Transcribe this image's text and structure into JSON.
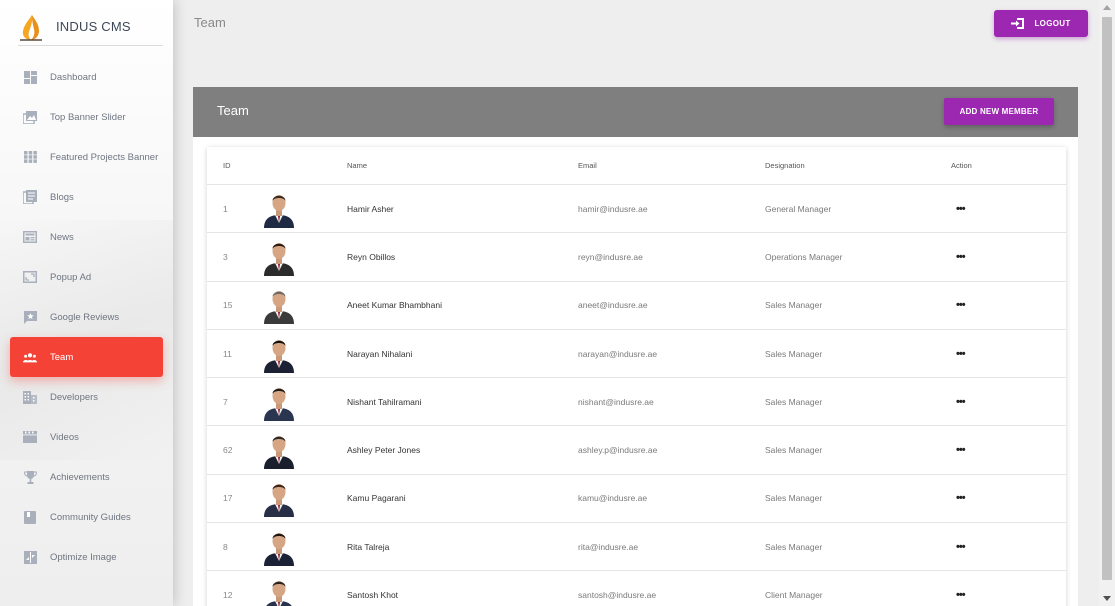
{
  "app": {
    "name": "INDUS CMS"
  },
  "header": {
    "page_title": "Team",
    "logout_label": "LOGOUT"
  },
  "sidebar": {
    "items": [
      {
        "label": "Dashboard",
        "icon": "dashboard-icon"
      },
      {
        "label": "Top Banner Slider",
        "icon": "image-icon"
      },
      {
        "label": "Featured Projects Banner",
        "icon": "grid-icon"
      },
      {
        "label": "Blogs",
        "icon": "blog-icon"
      },
      {
        "label": "News",
        "icon": "news-icon"
      },
      {
        "label": "Popup Ad",
        "icon": "popup-icon"
      },
      {
        "label": "Google Reviews",
        "icon": "review-icon"
      },
      {
        "label": "Team",
        "icon": "team-icon",
        "active": true
      },
      {
        "label": "Developers",
        "icon": "building-icon"
      },
      {
        "label": "Videos",
        "icon": "video-icon"
      },
      {
        "label": "Achievements",
        "icon": "trophy-icon"
      },
      {
        "label": "Community Guides",
        "icon": "book-icon"
      },
      {
        "label": "Optimize Image",
        "icon": "compress-icon"
      }
    ]
  },
  "card": {
    "title": "Team",
    "add_button": "ADD NEW MEMBER"
  },
  "table": {
    "headers": {
      "id": "ID",
      "name": "Name",
      "email": "Email",
      "designation": "Designation",
      "action": "Action"
    },
    "rows": [
      {
        "id": "1",
        "name": "Hamir Asher",
        "email": "hamir@indusre.ae",
        "designation": "General Manager"
      },
      {
        "id": "3",
        "name": "Reyn Obillos",
        "email": "reyn@indusre.ae",
        "designation": "Operations Manager"
      },
      {
        "id": "15",
        "name": "Aneet Kumar Bhambhani",
        "email": "aneet@indusre.ae",
        "designation": "Sales Manager"
      },
      {
        "id": "11",
        "name": "Narayan Nihalani",
        "email": "narayan@indusre.ae",
        "designation": "Sales Manager"
      },
      {
        "id": "7",
        "name": "Nishant Tahilramani",
        "email": "nishant@indusre.ae",
        "designation": "Sales Manager"
      },
      {
        "id": "62",
        "name": "Ashley Peter Jones",
        "email": "ashley.p@indusre.ae",
        "designation": "Sales Manager"
      },
      {
        "id": "17",
        "name": "Kamu Pagarani",
        "email": "kamu@indusre.ae",
        "designation": "Sales Manager"
      },
      {
        "id": "8",
        "name": "Rita Talreja",
        "email": "rita@indusre.ae",
        "designation": "Sales Manager"
      },
      {
        "id": "12",
        "name": "Santosh Khot",
        "email": "santosh@indusre.ae",
        "designation": "Client Manager"
      }
    ]
  },
  "colors": {
    "accent": "#9c27b0",
    "active_nav": "#f44336",
    "card_header": "#7f7f7f"
  }
}
